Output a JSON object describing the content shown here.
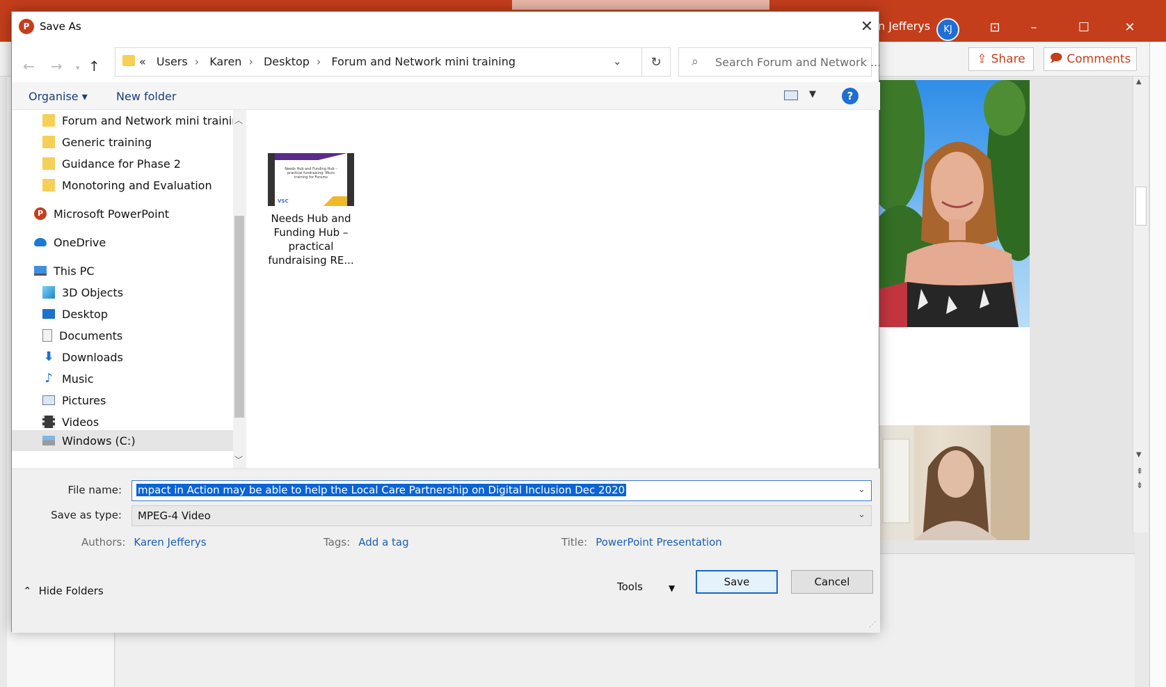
{
  "background": {
    "powerpoint_user": "n Jefferys",
    "avatar_initials": "KJ",
    "share_label": "Share",
    "comments_label": "Comments",
    "brand_color": "#c43e1c"
  },
  "dialog": {
    "title": "Save As",
    "address": {
      "prefix": "«",
      "crumbs": [
        "Users",
        "Karen",
        "Desktop",
        "Forum and Network mini training"
      ]
    },
    "search_placeholder": "Search Forum and Network ...",
    "toolbar": {
      "organise_label": "Organise ▾",
      "new_folder_label": "New folder"
    },
    "nav_items": [
      {
        "label": "Forum and Network mini training",
        "icon": "folder-icon"
      },
      {
        "label": "Generic training",
        "icon": "folder-icon"
      },
      {
        "label": "Guidance for Phase 2",
        "icon": "folder-icon"
      },
      {
        "label": "Monotoring and Evaluation",
        "icon": "folder-icon"
      },
      {
        "label": "Microsoft PowerPoint",
        "icon": "powerpoint-icon"
      },
      {
        "label": "OneDrive",
        "icon": "onedrive-icon"
      },
      {
        "label": "This PC",
        "icon": "pc-icon"
      },
      {
        "label": "3D Objects",
        "icon": "3d-objects-icon"
      },
      {
        "label": "Desktop",
        "icon": "desktop-icon"
      },
      {
        "label": "Documents",
        "icon": "documents-icon"
      },
      {
        "label": "Downloads",
        "icon": "downloads-icon"
      },
      {
        "label": "Music",
        "icon": "music-icon"
      },
      {
        "label": "Pictures",
        "icon": "pictures-icon"
      },
      {
        "label": "Videos",
        "icon": "videos-icon"
      },
      {
        "label": "Windows (C:)",
        "icon": "drive-icon"
      }
    ],
    "file": {
      "caption": "Needs Hub and Funding Hub – practical fundraising RE...",
      "thumbnail_text": "Needs Hub and Funding Hub – practical fundraising: Micro training for Forums",
      "thumbnail_logo": "VSC"
    },
    "form": {
      "file_name_label": "File name:",
      "file_name_value": "mpact in Action may be able to help the Local Care Partnership on Digital Inclusion Dec 2020",
      "save_type_label": "Save as type:",
      "save_type_value": "MPEG-4 Video",
      "authors_label": "Authors:",
      "authors_value": "Karen Jefferys",
      "tags_label": "Tags:",
      "tags_value": "Add a tag",
      "title_label": "Title:",
      "title_value": "PowerPoint Presentation"
    },
    "hide_folders_label": "Hide Folders",
    "tools_label": "Tools",
    "save_label": "Save",
    "cancel_label": "Cancel"
  }
}
